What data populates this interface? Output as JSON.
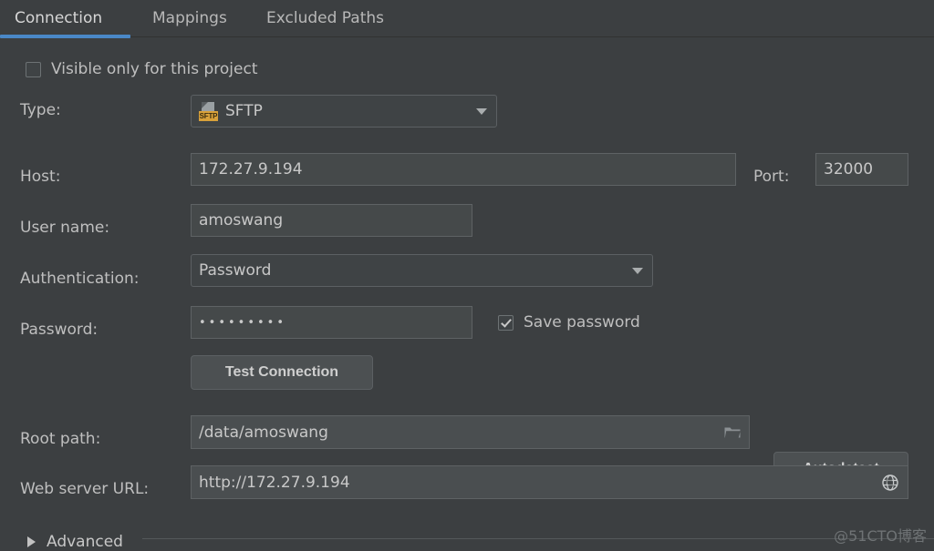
{
  "window": {
    "background_color": "#3c3f41",
    "accent_color": "#4a88c7"
  },
  "tabs": [
    {
      "label": "Connection",
      "selected": true
    },
    {
      "label": "Mappings",
      "selected": false
    },
    {
      "label": "Excluded Paths",
      "selected": false
    }
  ],
  "form": {
    "visible_only_checkbox": {
      "label": "Visible only for this project",
      "checked": false
    },
    "type": {
      "label": "Type:",
      "value": "SFTP",
      "icon_badge": "SFTP"
    },
    "host": {
      "label": "Host:",
      "value": "172.27.9.194"
    },
    "port": {
      "label": "Port:",
      "value": "32000"
    },
    "user_name": {
      "label": "User name:",
      "value": "amoswang"
    },
    "authentication": {
      "label": "Authentication:",
      "value": "Password"
    },
    "password": {
      "label": "Password:",
      "value": "•••••••••"
    },
    "save_password_checkbox": {
      "label": "Save password",
      "checked": true
    },
    "test_connection_button": {
      "label": "Test Connection"
    },
    "root_path": {
      "label": "Root path:",
      "value": "/data/amoswang"
    },
    "autodetect_button": {
      "label": "Autodetect"
    },
    "web_server_url": {
      "label": "Web server URL:",
      "value": "http://172.27.9.194"
    },
    "advanced": {
      "label": "Advanced",
      "expanded": false
    }
  },
  "watermark": {
    "text": "@51CTO博客"
  }
}
